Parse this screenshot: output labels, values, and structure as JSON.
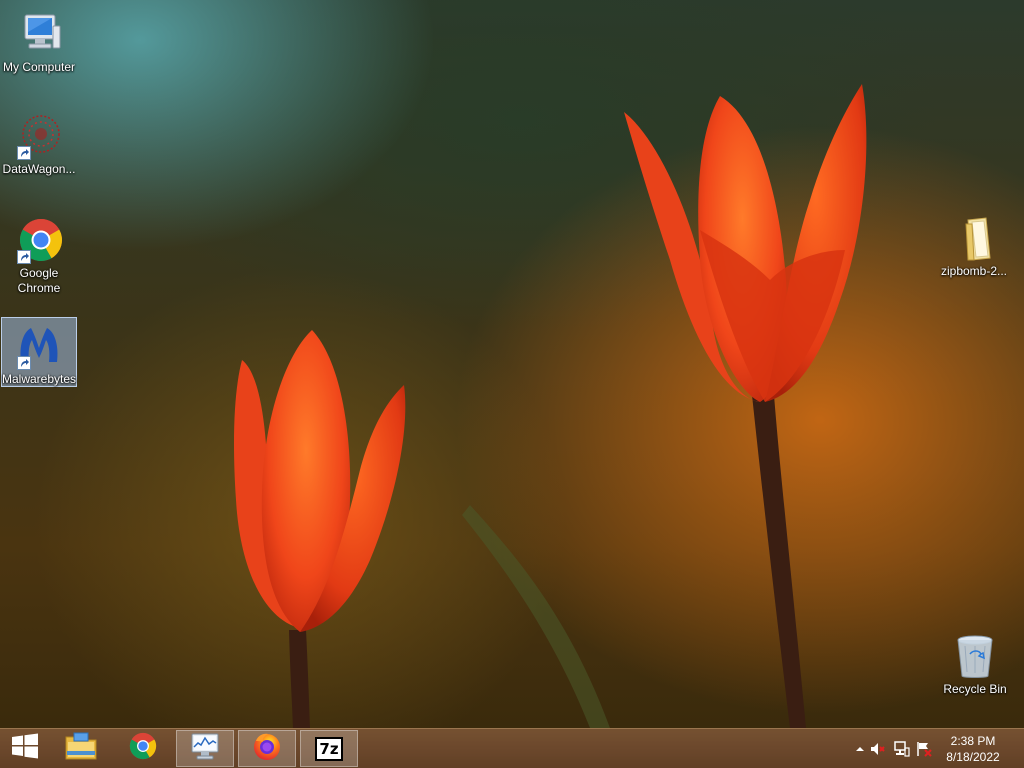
{
  "desktop": {
    "icons": [
      {
        "label": "My Computer",
        "icon": "computer-icon"
      },
      {
        "label": "DataWagon...",
        "icon": "datawagon-icon"
      },
      {
        "label": "Google\nChrome",
        "icon": "chrome-icon"
      },
      {
        "label": "Malwarebytes",
        "icon": "malwarebytes-icon",
        "selected": true
      },
      {
        "label": "zipbomb-2...",
        "icon": "folder-icon"
      },
      {
        "label": "Recycle Bin",
        "icon": "recycle-bin-icon"
      }
    ]
  },
  "taskbar": {
    "buttons": [
      {
        "name": "start",
        "icon": "windows-logo-icon"
      },
      {
        "name": "file-explorer",
        "icon": "folder-icon"
      },
      {
        "name": "chrome",
        "icon": "chrome-icon"
      },
      {
        "name": "performance-monitor",
        "icon": "monitor-chart-icon",
        "active": true
      },
      {
        "name": "firefox",
        "icon": "firefox-icon",
        "active": true
      },
      {
        "name": "7zip",
        "icon": "7zip-icon",
        "label": "7z",
        "active": true
      }
    ],
    "tray": {
      "icons": [
        "show-hidden-icons-arrow",
        "speaker-muted-icon",
        "network-icon",
        "action-center-flag-icon"
      ]
    },
    "clock": {
      "time": "2:38 PM",
      "date": "8/18/2022"
    }
  },
  "colors": {
    "taskbar": "#6c4a2c",
    "selection": "#a0bee6",
    "tulip": "#f04a1a",
    "stem": "#3a1e12"
  }
}
